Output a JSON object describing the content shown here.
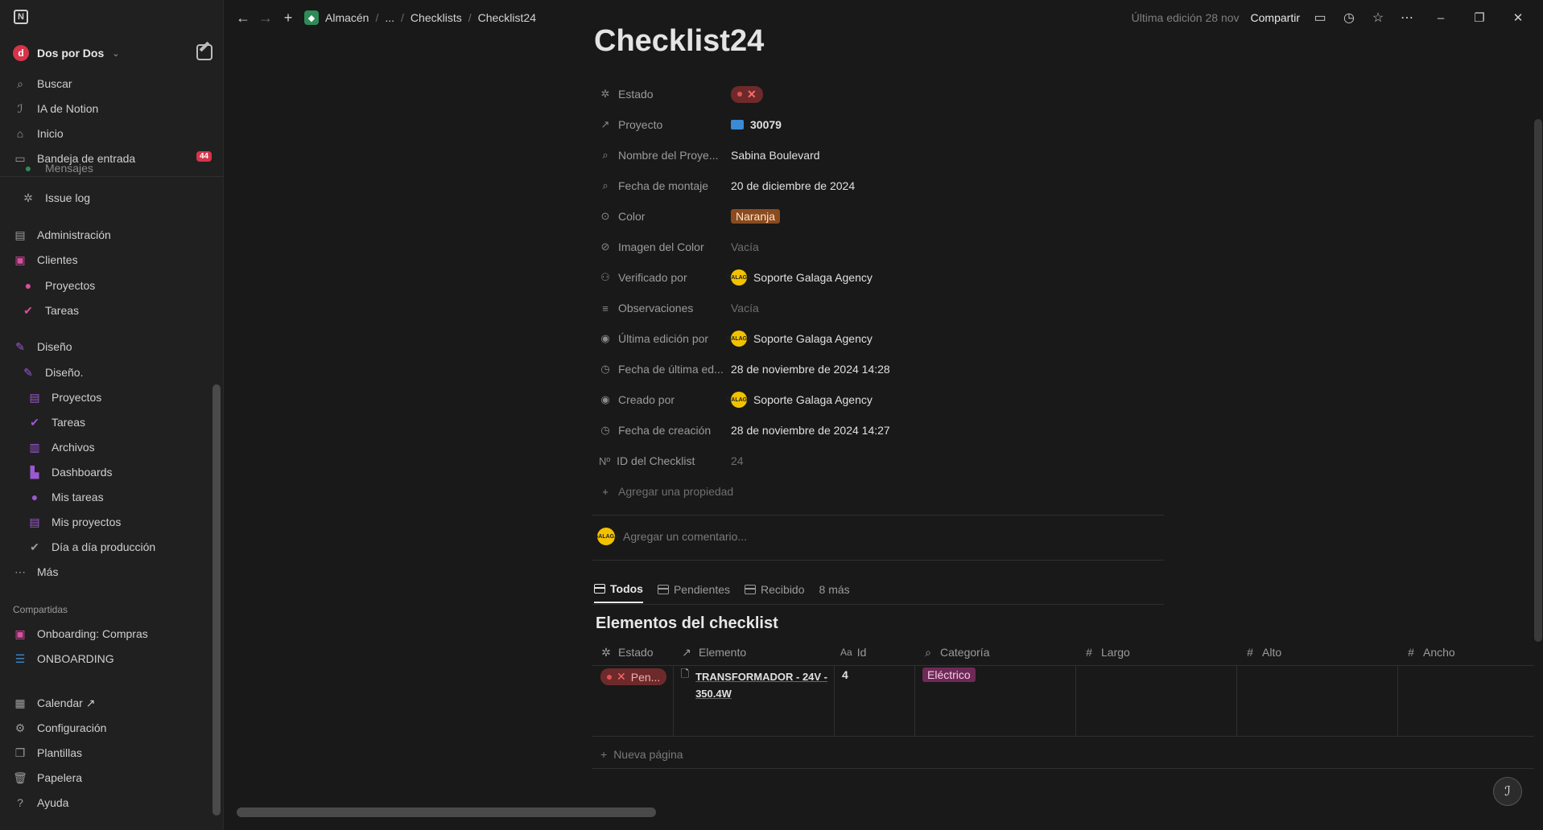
{
  "sidebar": {
    "workspace": "Dos por Dos",
    "workspace_initial": "d",
    "top_items": [
      {
        "label": "Buscar",
        "icon": "search-icon"
      },
      {
        "label": "IA de Notion",
        "icon": "ai-icon"
      },
      {
        "label": "Inicio",
        "icon": "home-icon"
      },
      {
        "label": "Bandeja de entrada",
        "icon": "inbox-icon"
      }
    ],
    "inbox_count": "44",
    "partial_item": "Mensajes",
    "issue_log": "Issue log",
    "tree": [
      {
        "label": "Administración",
        "icon": "admin-icon"
      },
      {
        "label": "Clientes",
        "icon": "clients-icon"
      },
      {
        "label": "Proyectos",
        "icon": "projects-icon"
      },
      {
        "label": "Tareas",
        "icon": "tasks-icon"
      },
      {
        "label": "Diseño",
        "icon": "design-icon"
      },
      {
        "label": "Diseño.",
        "icon": "design-icon"
      },
      {
        "label": "Proyectos",
        "icon": "projects-icon"
      },
      {
        "label": "Tareas",
        "icon": "tasks-icon"
      },
      {
        "label": "Archivos",
        "icon": "archive-icon"
      },
      {
        "label": "Dashboards",
        "icon": "dashboard-icon"
      },
      {
        "label": "Mis tareas",
        "icon": "user-icon"
      },
      {
        "label": "Mis proyectos",
        "icon": "projects-icon"
      },
      {
        "label": "Día a día producción",
        "icon": "check-icon"
      },
      {
        "label": "Más",
        "icon": "more-icon"
      }
    ],
    "shared_label": "Compartidas",
    "shared": [
      {
        "label": "Onboarding: Compras",
        "icon": "clients-icon"
      },
      {
        "label": "ONBOARDING",
        "icon": "list-icon"
      }
    ],
    "bottom": [
      {
        "label": "Calendar ↗",
        "icon": "calendar-icon"
      },
      {
        "label": "Configuración",
        "icon": "gear-icon"
      },
      {
        "label": "Plantillas",
        "icon": "templates-icon"
      },
      {
        "label": "Papelera",
        "icon": "trash-icon"
      },
      {
        "label": "Ayuda",
        "icon": "help-icon"
      }
    ]
  },
  "topbar": {
    "crumbs": [
      "Almacén",
      "...",
      "Checklists",
      "Checklist24"
    ],
    "last_edit": "Última edición 28 nov",
    "share": "Compartir"
  },
  "page": {
    "title": "Checklist24",
    "properties": [
      {
        "key": "Estado",
        "icon": "status-icon",
        "value": "✕",
        "type": "status"
      },
      {
        "key": "Proyecto",
        "icon": "relation-icon",
        "value": "30079",
        "type": "relation"
      },
      {
        "key": "Nombre del Proye...",
        "icon": "lookup-icon",
        "value": "Sabina Boulevard",
        "type": "text"
      },
      {
        "key": "Fecha de montaje",
        "icon": "lookup-icon",
        "value": "20 de diciembre de 2024",
        "type": "text"
      },
      {
        "key": "Color",
        "icon": "select-icon",
        "value": "Naranja",
        "type": "tag"
      },
      {
        "key": "Imagen del Color",
        "icon": "attachment-icon",
        "value": "Vacía",
        "type": "empty"
      },
      {
        "key": "Verificado por",
        "icon": "people-icon",
        "value": "Soporte Galaga Agency",
        "type": "user"
      },
      {
        "key": "Observaciones",
        "icon": "text-icon",
        "value": "Vacía",
        "type": "empty"
      },
      {
        "key": "Última edición por",
        "icon": "person-icon",
        "value": "Soporte Galaga Agency",
        "type": "user"
      },
      {
        "key": "Fecha de última ed...",
        "icon": "clock-icon",
        "value": "28 de noviembre de 2024 14:28",
        "type": "text"
      },
      {
        "key": "Creado por",
        "icon": "person-icon",
        "value": "Soporte Galaga Agency",
        "type": "user"
      },
      {
        "key": "Fecha de creación",
        "icon": "clock-icon",
        "value": "28 de noviembre de 2024 14:27",
        "type": "text"
      },
      {
        "key": "ID del Checklist",
        "icon": "id-icon",
        "value": "24",
        "type": "empty"
      }
    ],
    "add_property": "Agregar una propiedad",
    "comment_placeholder": "Agregar un comentario...",
    "user_avatar_text": "GALAGA"
  },
  "database": {
    "tabs": [
      "Todos",
      "Pendientes",
      "Recibido",
      "8 más"
    ],
    "title": "Elementos del checklist",
    "columns": [
      {
        "label": "Estado",
        "icon": "status-icon"
      },
      {
        "label": "Elemento",
        "icon": "relation-icon"
      },
      {
        "label": "Id",
        "icon": "text-type-icon"
      },
      {
        "label": "Categoría",
        "icon": "lookup-icon"
      },
      {
        "label": "Largo",
        "icon": "number-icon"
      },
      {
        "label": "Alto",
        "icon": "number-icon"
      },
      {
        "label": "Ancho",
        "icon": "number-icon"
      }
    ],
    "rows": [
      {
        "estado": "Pen...",
        "elemento": "TRANSFORMADOR - 24V - 350.4W",
        "id": "4",
        "categoria": "Eléctrico"
      }
    ],
    "new_page": "Nueva página"
  },
  "colors": {
    "accent_red": "#d6344a",
    "orange_tag": "#8a4b1f",
    "pink_tag": "#6e2a56",
    "avatar_yellow": "#f2c200"
  }
}
